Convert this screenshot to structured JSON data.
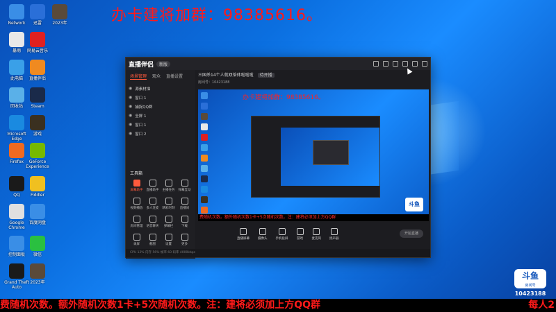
{
  "desktop": {
    "promo": "办卡建将加群：98385616。",
    "icons": [
      {
        "label": "Network",
        "color": "#3a8ee6"
      },
      {
        "label": "迅雷",
        "color": "#2a6fd8"
      },
      {
        "label": "2023年",
        "color": "#5a4a3a"
      },
      {
        "label": "暴雨",
        "color": "#e8e8e8"
      },
      {
        "label": "网易云音乐",
        "color": "#e02020"
      },
      {
        "label": "此电脑",
        "color": "#3aa0e8"
      },
      {
        "label": "直播伴侣",
        "color": "#f08a20"
      },
      {
        "label": "回收站",
        "color": "#5ab0e8"
      },
      {
        "label": "Steam",
        "color": "#1a2a4a"
      },
      {
        "label": "Microsoft Edge",
        "color": "#1a8ae0"
      },
      {
        "label": "游戏",
        "color": "#3a3020"
      },
      {
        "label": "Firefox",
        "color": "#f06a20"
      },
      {
        "label": "GeForce Experience",
        "color": "#76b900"
      },
      {
        "label": "QQ",
        "color": "#1a1a1a"
      },
      {
        "label": "Fiddler",
        "color": "#f0c020"
      },
      {
        "label": "Google Chrome",
        "color": "#e0e0e0"
      },
      {
        "label": "百度网盘",
        "color": "#3a8ee6"
      },
      {
        "label": "控制面板",
        "color": "#3a8ee6"
      },
      {
        "label": "微信",
        "color": "#2ac040"
      },
      {
        "label": "Grand Theft Auto",
        "color": "#1a1a1a"
      },
      {
        "label": "2023年",
        "color": "#5a4a3a"
      }
    ]
  },
  "app": {
    "title": "直播伴侣",
    "version": "新版",
    "tabs": [
      "场景管理",
      "观众",
      "直播设置"
    ],
    "scenes": [
      "源素材描",
      "窗口 1",
      "捕捉QQ群",
      "全屏 1",
      "窗口 1",
      "窗口 2"
    ],
    "tools_title": "工具箱",
    "tools": [
      "屏幕助手",
      "直播助手",
      "主播任务",
      "弹幕互动",
      "视频播放",
      "多人连麦",
      "精彩时刻",
      "直播间",
      "房间管理",
      "语音聊天",
      "弹幕栏",
      "下载",
      "录屏",
      "截图",
      "设置",
      "更多"
    ],
    "room_title": "三国杀14个人就双倍体啦啦啦",
    "room_tag": "待开播",
    "room_sub": "房间号：10423188",
    "preview_promo": "办卡建将加群：98385616。",
    "preview_ticker": "费随机次数。额外随机次数1卡+5次随机次数。注：建将必须加上方QQ群",
    "mini_logo": "斗鱼",
    "bottom_tools": [
      "直播屏幕",
      "摄像头",
      "手机投屏",
      "游戏",
      "麦克风",
      "扬声器"
    ],
    "start_live": "开始直播",
    "status": "CPU 12%   内存 56%   帧率 60   码率 4000kbps"
  },
  "ticker": "费随机次数。额外随机次数1卡+5次随机次数。注：建将必须加上方QQ群",
  "ticker_right": "每人2",
  "douyu": {
    "logo": "斗鱼",
    "sub": "房间号",
    "room_id": "10423188"
  }
}
